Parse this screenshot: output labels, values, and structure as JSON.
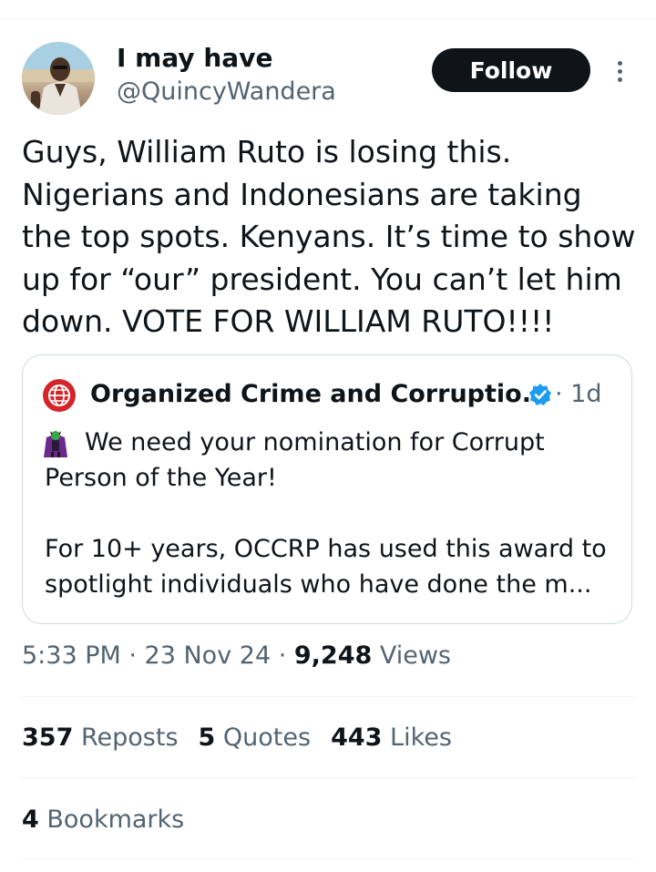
{
  "author": {
    "display_name": "I may have",
    "handle": "@QuincyWandera",
    "follow_label": "Follow"
  },
  "tweet": {
    "lines": [
      "Guys, William Ruto is losing this.",
      "Nigerians and Indonesians are taking",
      "the top spots. Kenyans. It’s time to show",
      "up for “our” president. You can’t let him",
      "down.  VOTE FOR WILLIAM RUTO!!!!"
    ]
  },
  "quote": {
    "name": "Organized Crime and Corruptio...",
    "time": "· 1d",
    "lines": [
      "We need your nomination for Corrupt",
      "Person of the Year!",
      "For 10+ years, OCCRP has used this award to",
      "spotlight individuals who have done the m..."
    ],
    "accent_color": "#d4262a",
    "verified_color": "#1d9bf0"
  },
  "meta": {
    "time": "5:33 PM",
    "sep1": " · ",
    "date": "23 Nov 24",
    "sep2": " · ",
    "views_count": "9,248",
    "views_label": " Views"
  },
  "stats": {
    "reposts_count": "357",
    "reposts_label": "Reposts",
    "quotes_count": "5",
    "quotes_label": "Quotes",
    "likes_count": "443",
    "likes_label": "Likes",
    "bookmarks_count": "4",
    "bookmarks_label": "Bookmarks"
  },
  "icons": {
    "more": "more-options-icon",
    "verified": "verified-badge-icon",
    "logo": "occrp-logo-icon",
    "emoji": "villain-emoji-icon"
  }
}
